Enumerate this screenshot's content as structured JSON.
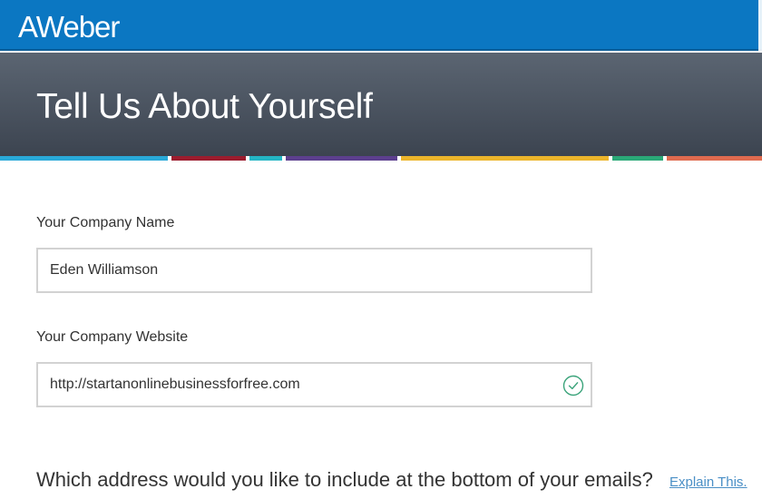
{
  "header": {
    "logo_text": "AWeber",
    "brand_color": "#0b77c2"
  },
  "hero": {
    "title": "Tell Us About Yourself"
  },
  "stripe_colors": [
    "#29a9d8",
    "#9b1c2e",
    "#24b5c4",
    "#5c3f8e",
    "#ecb52b",
    "#2aa877",
    "#e06a4f"
  ],
  "form": {
    "company_name": {
      "label": "Your Company Name",
      "value": "Eden Williamson"
    },
    "company_website": {
      "label": "Your Company Website",
      "value": "http://startanonlinebusinessforfree.com",
      "status_icon": "check-circle-icon",
      "status_color": "#3aa37a"
    }
  },
  "address_section": {
    "question": "Which address would you like to include at the bottom of your emails?",
    "help_link": "Explain This."
  }
}
